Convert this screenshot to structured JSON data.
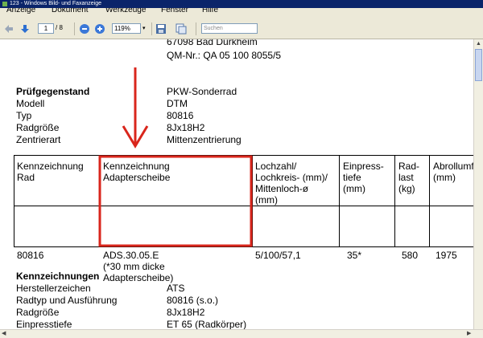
{
  "window": {
    "title": "123 - Windows Bild- und Faxanzeige"
  },
  "menu": [
    "Anzeige",
    "Dokument",
    "Werkzeuge",
    "Fenster",
    "Hilfe"
  ],
  "toolbar": {
    "page_current": "1",
    "page_total": "/ 8",
    "zoom": "119%",
    "search_placeholder": "Suchen"
  },
  "doc": {
    "header_line1": "67098 Bad Dürkheim",
    "header_line2": "QM-Nr.: QA 05 100 8055/5",
    "pruef": {
      "heading": "Prüfgegenstand",
      "rows": [
        {
          "label": "Modell",
          "value": "DTM"
        },
        {
          "label": "Typ",
          "value": "80816"
        },
        {
          "label": "Radgröße",
          "value": "8Jx18H2"
        },
        {
          "label": "Zentrierart",
          "value": "Mittenzentrierung"
        }
      ],
      "head_value": "PKW-Sonderrad"
    },
    "table": {
      "headers": [
        [
          "Kennzeichnung",
          "Rad"
        ],
        [
          "Kennzeichnung",
          "Adapterscheibe"
        ],
        [
          "Lochzahl/",
          "Lochkreis- (mm)/",
          "Mittenloch-ø",
          "(mm)"
        ],
        [
          "Einpress-",
          "tiefe",
          "(mm)"
        ],
        [
          "Rad-",
          "last",
          "(kg)"
        ],
        [
          "Abrollumfa",
          "(mm)"
        ]
      ],
      "row": [
        [
          "80816"
        ],
        [
          "ADS.30.05.E",
          "(*30 mm dicke",
          "Adapterscheibe)"
        ],
        [
          "5/100/57,1"
        ],
        [
          "35*"
        ],
        [
          "580"
        ],
        [
          "1975"
        ]
      ]
    },
    "kenn": {
      "heading": "Kennzeichnungen",
      "rows": [
        {
          "label": "Herstellerzeichen",
          "value": "ATS"
        },
        {
          "label": "Radtyp und Ausführung",
          "value": "80816 (s.o.)"
        },
        {
          "label": "Radgröße",
          "value": "8Jx18H2"
        },
        {
          "label": "Einpresstiefe",
          "value": "ET 65 (Radkörper)"
        }
      ]
    }
  },
  "colors": {
    "annotation": "#d9261c",
    "titlebar": "#0a246a",
    "chrome": "#ece9d8"
  }
}
